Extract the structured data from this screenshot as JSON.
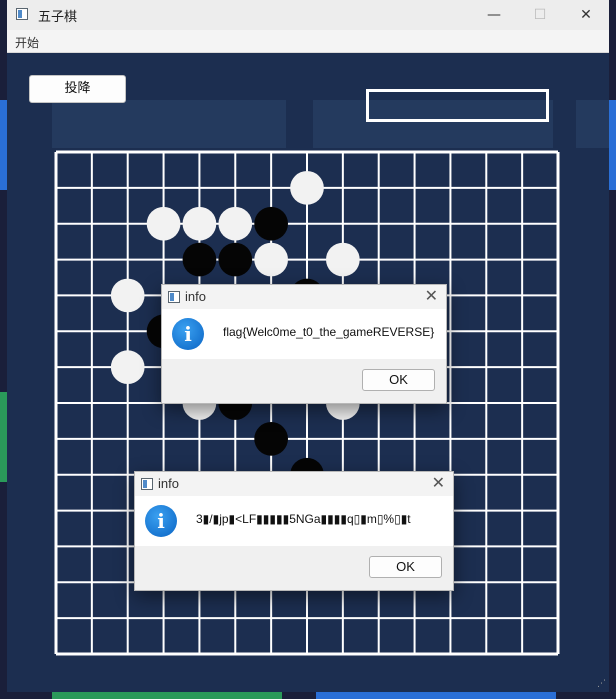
{
  "window": {
    "title": "五子棋",
    "minimize_glyph": "—",
    "maximize_glyph": "☐",
    "close_glyph": "✕"
  },
  "menu": {
    "items": [
      "开始"
    ]
  },
  "game": {
    "surrender_label": "投降",
    "status_text": ""
  },
  "board": {
    "grid_size": 14,
    "line_color": "#ffffff",
    "background": "#1c2e50"
  },
  "stones": [
    {
      "row": 1,
      "col": 7,
      "color": "white"
    },
    {
      "row": 2,
      "col": 3,
      "color": "white"
    },
    {
      "row": 2,
      "col": 4,
      "color": "white"
    },
    {
      "row": 2,
      "col": 5,
      "color": "white"
    },
    {
      "row": 2,
      "col": 6,
      "color": "black"
    },
    {
      "row": 3,
      "col": 4,
      "color": "black"
    },
    {
      "row": 3,
      "col": 5,
      "color": "black"
    },
    {
      "row": 3,
      "col": 6,
      "color": "white"
    },
    {
      "row": 3,
      "col": 8,
      "color": "white"
    },
    {
      "row": 4,
      "col": 2,
      "color": "white"
    },
    {
      "row": 4,
      "col": 7,
      "color": "black"
    },
    {
      "row": 5,
      "col": 3,
      "color": "black"
    },
    {
      "row": 6,
      "col": 2,
      "color": "white"
    },
    {
      "row": 7,
      "col": 4,
      "color": "white"
    },
    {
      "row": 7,
      "col": 5,
      "color": "black"
    },
    {
      "row": 7,
      "col": 8,
      "color": "white"
    },
    {
      "row": 8,
      "col": 6,
      "color": "black"
    },
    {
      "row": 9,
      "col": 7,
      "color": "black"
    }
  ],
  "dialogs": [
    {
      "title": "info",
      "message": "flag{Welc0me_t0_the_gameREVERSE}",
      "ok_label": "OK",
      "close_glyph": "✕",
      "info_glyph": "i"
    },
    {
      "title": "info",
      "message": "3▮/▮jp▮<LF▮▮▮▮▮5NGa▮▮▮▮q▯▮m▯%▯▮t",
      "ok_label": "OK",
      "close_glyph": "✕",
      "info_glyph": "i"
    }
  ],
  "resize_glyph": "⋰",
  "colors": {
    "accent_blue": "#1a73d1",
    "board_bg": "#1c2e50",
    "grid": "#ffffff"
  }
}
